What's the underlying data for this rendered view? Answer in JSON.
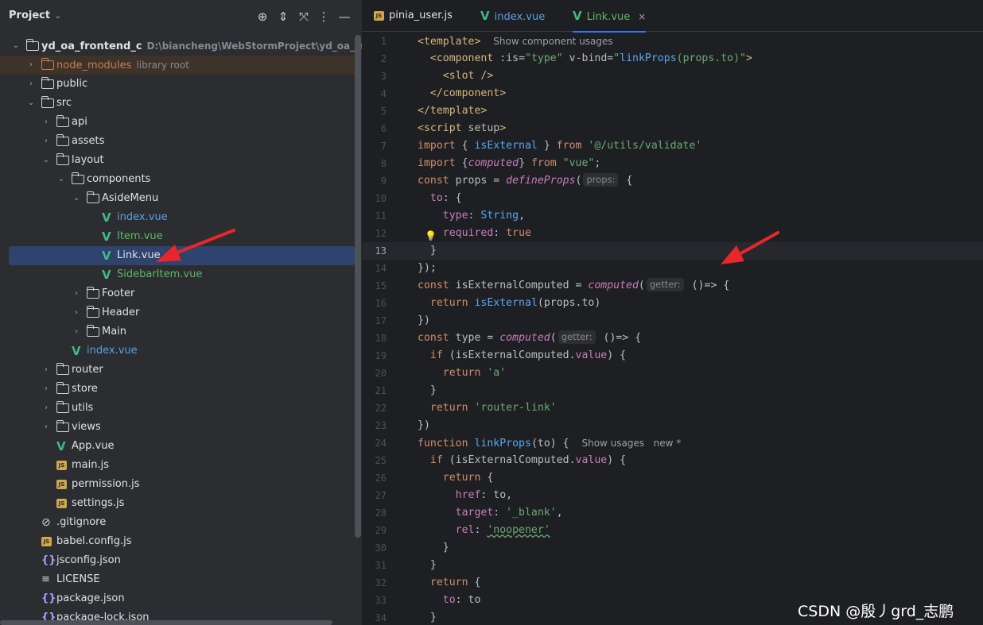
{
  "panel": {
    "title": "Project",
    "chevron": "⌄",
    "icons": [
      "crosshair-icon",
      "expand-all-icon",
      "collapse-all-icon",
      "more-icon",
      "minimize-icon"
    ]
  },
  "tree": [
    {
      "name": "yd_oa_frontend_c",
      "hint": "D:\\biancheng\\WebStormProject\\yd_oa_frontend_c",
      "depth": 0,
      "arrow": "⌄",
      "icon": "folder",
      "bold": true
    },
    {
      "name": "node_modules",
      "hint": "library root",
      "depth": 1,
      "arrow": "›",
      "icon": "folder-orange",
      "style": "orange",
      "excluded": true
    },
    {
      "name": "public",
      "depth": 1,
      "arrow": "›",
      "icon": "folder"
    },
    {
      "name": "src",
      "depth": 1,
      "arrow": "⌄",
      "icon": "folder"
    },
    {
      "name": "api",
      "depth": 2,
      "arrow": "›",
      "icon": "folder"
    },
    {
      "name": "assets",
      "depth": 2,
      "arrow": "›",
      "icon": "folder"
    },
    {
      "name": "layout",
      "depth": 2,
      "arrow": "⌄",
      "icon": "folder"
    },
    {
      "name": "components",
      "depth": 3,
      "arrow": "⌄",
      "icon": "folder"
    },
    {
      "name": "AsideMenu",
      "depth": 4,
      "arrow": "⌄",
      "icon": "folder"
    },
    {
      "name": "index.vue",
      "depth": 5,
      "icon": "vue",
      "style": "blue"
    },
    {
      "name": "Item.vue",
      "depth": 5,
      "icon": "vue",
      "style": "green"
    },
    {
      "name": "Link.vue",
      "depth": 5,
      "icon": "vue",
      "selected": true
    },
    {
      "name": "SidebarItem.vue",
      "depth": 5,
      "icon": "vue",
      "style": "green"
    },
    {
      "name": "Footer",
      "depth": 4,
      "arrow": "›",
      "icon": "folder"
    },
    {
      "name": "Header",
      "depth": 4,
      "arrow": "›",
      "icon": "folder"
    },
    {
      "name": "Main",
      "depth": 4,
      "arrow": "›",
      "icon": "folder"
    },
    {
      "name": "index.vue",
      "depth": 3,
      "icon": "vue",
      "style": "blue"
    },
    {
      "name": "router",
      "depth": 2,
      "arrow": "›",
      "icon": "folder"
    },
    {
      "name": "store",
      "depth": 2,
      "arrow": "›",
      "icon": "folder"
    },
    {
      "name": "utils",
      "depth": 2,
      "arrow": "›",
      "icon": "folder"
    },
    {
      "name": "views",
      "depth": 2,
      "arrow": "›",
      "icon": "folder"
    },
    {
      "name": "App.vue",
      "depth": 2,
      "icon": "vue"
    },
    {
      "name": "main.js",
      "depth": 2,
      "icon": "js"
    },
    {
      "name": "permission.js",
      "depth": 2,
      "icon": "js"
    },
    {
      "name": "settings.js",
      "depth": 2,
      "icon": "js"
    },
    {
      "name": ".gitignore",
      "depth": 1,
      "icon": "ignore"
    },
    {
      "name": "babel.config.js",
      "depth": 1,
      "icon": "js"
    },
    {
      "name": "jsconfig.json",
      "depth": 1,
      "icon": "json"
    },
    {
      "name": "LICENSE",
      "depth": 1,
      "icon": "text"
    },
    {
      "name": "package.json",
      "depth": 1,
      "icon": "json"
    },
    {
      "name": "package-lock.json",
      "depth": 1,
      "icon": "json"
    }
  ],
  "tabs": [
    {
      "label": "pinia_user.js",
      "icon": "js",
      "style": ""
    },
    {
      "label": "index.vue",
      "icon": "vue",
      "style": "blue"
    },
    {
      "label": "Link.vue",
      "icon": "vue",
      "style": "green",
      "active": true,
      "close": "×"
    }
  ],
  "code": {
    "current_line": 13,
    "lines": [
      [
        [
          "tg",
          "<template>"
        ],
        [
          "t",
          "  "
        ],
        [
          "hn",
          "Show component usages"
        ]
      ],
      [
        [
          "t",
          "  "
        ],
        [
          "tg",
          "<component"
        ],
        [
          "t",
          " "
        ],
        [
          "at",
          ":is"
        ],
        [
          "t",
          "="
        ],
        [
          "st",
          "\"type\""
        ],
        [
          "t",
          " "
        ],
        [
          "at",
          "v-bind"
        ],
        [
          "t",
          "="
        ],
        [
          "st",
          "\""
        ],
        [
          "fn",
          "linkProps"
        ],
        [
          "st",
          "(props.to)\""
        ],
        [
          "tg",
          ">"
        ]
      ],
      [
        [
          "t",
          "    "
        ],
        [
          "tg",
          "<slot"
        ],
        [
          "t",
          " "
        ],
        [
          "tg",
          "/>"
        ]
      ],
      [
        [
          "t",
          "  "
        ],
        [
          "tg",
          "</component>"
        ]
      ],
      [
        [
          "tg",
          "</template>"
        ]
      ],
      [
        [
          "tg",
          "<script"
        ],
        [
          "t",
          " "
        ],
        [
          "at",
          "setup"
        ],
        [
          "tg",
          ">"
        ]
      ],
      [
        [
          "kw",
          "import"
        ],
        [
          "t",
          " { "
        ],
        [
          "fn",
          "isExternal"
        ],
        [
          "t",
          " } "
        ],
        [
          "kw",
          "from"
        ],
        [
          "t",
          " "
        ],
        [
          "st",
          "'@/utils/validate'"
        ]
      ],
      [
        [
          "kw",
          "import"
        ],
        [
          "t",
          " {"
        ],
        [
          "fi",
          "computed"
        ],
        [
          "t",
          "} "
        ],
        [
          "kw",
          "from"
        ],
        [
          "t",
          " "
        ],
        [
          "st",
          "\"vue\""
        ],
        [
          "t",
          ";"
        ]
      ],
      [
        [
          "kw",
          "const"
        ],
        [
          "t",
          " props = "
        ],
        [
          "fi",
          "defineProps"
        ],
        [
          "t",
          "("
        ],
        [
          "badge",
          "props:"
        ],
        [
          "t",
          " {"
        ]
      ],
      [
        [
          "t",
          "  "
        ],
        [
          "pr",
          "to"
        ],
        [
          "t",
          ": {"
        ]
      ],
      [
        [
          "t",
          "    "
        ],
        [
          "pr",
          "type"
        ],
        [
          "t",
          ": "
        ],
        [
          "fn",
          "String"
        ],
        [
          "t",
          ","
        ]
      ],
      [
        [
          "t",
          "    "
        ],
        [
          "pr",
          "required"
        ],
        [
          "t",
          ": "
        ],
        [
          "kw",
          "true"
        ]
      ],
      [
        [
          "t",
          "  }"
        ]
      ],
      [
        [
          "t",
          "});"
        ]
      ],
      [
        [
          "kw",
          "const"
        ],
        [
          "t",
          " isExternalComputed = "
        ],
        [
          "fi",
          "computed"
        ],
        [
          "t",
          "("
        ],
        [
          "badge",
          "getter:"
        ],
        [
          "t",
          " ()=> {"
        ]
      ],
      [
        [
          "t",
          "  "
        ],
        [
          "kw",
          "return"
        ],
        [
          "t",
          " "
        ],
        [
          "fn",
          "isExternal"
        ],
        [
          "t",
          "(props.to)"
        ]
      ],
      [
        [
          "t",
          "})"
        ]
      ],
      [
        [
          "kw",
          "const"
        ],
        [
          "t",
          " type = "
        ],
        [
          "fi",
          "computed"
        ],
        [
          "t",
          "("
        ],
        [
          "badge",
          "getter:"
        ],
        [
          "t",
          " ()=> {"
        ]
      ],
      [
        [
          "t",
          "  "
        ],
        [
          "kw",
          "if"
        ],
        [
          "t",
          " (isExternalComputed."
        ],
        [
          "pr",
          "value"
        ],
        [
          "t",
          ") {"
        ]
      ],
      [
        [
          "t",
          "    "
        ],
        [
          "kw",
          "return"
        ],
        [
          "t",
          " "
        ],
        [
          "st",
          "'a'"
        ]
      ],
      [
        [
          "t",
          "  }"
        ]
      ],
      [
        [
          "t",
          "  "
        ],
        [
          "kw",
          "return"
        ],
        [
          "t",
          " "
        ],
        [
          "st",
          "'router-link'"
        ]
      ],
      [
        [
          "t",
          "})"
        ]
      ],
      [
        [
          "kw",
          "function"
        ],
        [
          "t",
          " "
        ],
        [
          "fn",
          "linkProps"
        ],
        [
          "t",
          "(to) {  "
        ],
        [
          "hn",
          "Show usages   new *"
        ]
      ],
      [
        [
          "t",
          "  "
        ],
        [
          "kw",
          "if"
        ],
        [
          "t",
          " (isExternalComputed."
        ],
        [
          "pr",
          "value"
        ],
        [
          "t",
          ") {"
        ]
      ],
      [
        [
          "t",
          "    "
        ],
        [
          "kw",
          "return"
        ],
        [
          "t",
          " {"
        ]
      ],
      [
        [
          "t",
          "      "
        ],
        [
          "pr",
          "href"
        ],
        [
          "t",
          ": to,"
        ]
      ],
      [
        [
          "t",
          "      "
        ],
        [
          "pr",
          "target"
        ],
        [
          "t",
          ": "
        ],
        [
          "st",
          "'_blank'"
        ],
        [
          "t",
          ","
        ]
      ],
      [
        [
          "t",
          "      "
        ],
        [
          "pr",
          "rel"
        ],
        [
          "t",
          ": "
        ],
        [
          "sq",
          "'noopener'"
        ]
      ],
      [
        [
          "t",
          "    }"
        ]
      ],
      [
        [
          "t",
          "  }"
        ]
      ],
      [
        [
          "t",
          "  "
        ],
        [
          "kw",
          "return"
        ],
        [
          "t",
          " {"
        ]
      ],
      [
        [
          "t",
          "    "
        ],
        [
          "pr",
          "to"
        ],
        [
          "t",
          ": to"
        ]
      ],
      [
        [
          "t",
          "  }"
        ]
      ]
    ]
  },
  "watermark": "CSDN @殷丿grd_志鹏",
  "colors": {
    "accent": "#3574f0",
    "selection": "#2e436e",
    "arrow": "#e8262b"
  }
}
